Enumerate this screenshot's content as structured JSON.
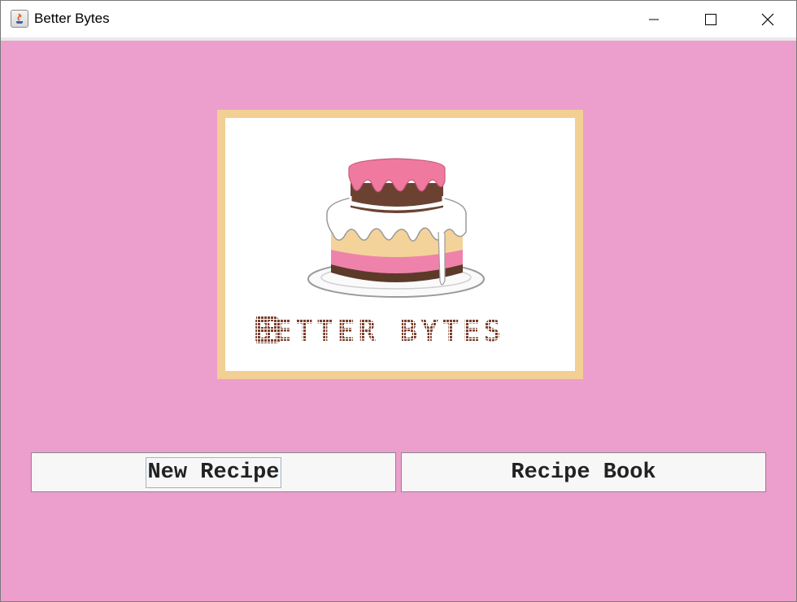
{
  "window": {
    "title": "Better Bytes",
    "icon": "java-cup-icon"
  },
  "titlebar_controls": {
    "minimize": "minimize-icon",
    "maximize": "maximize-icon",
    "close": "close-icon"
  },
  "logo": {
    "text": "BETTER BYTES",
    "image": "layered-cake-illustration"
  },
  "buttons": {
    "new_recipe": "New Recipe",
    "recipe_book": "Recipe Book",
    "focused": "New Recipe"
  },
  "colors": {
    "background": "#ec9ecd",
    "logo_border": "#f2cf92",
    "button_face": "#f7f7f7"
  }
}
